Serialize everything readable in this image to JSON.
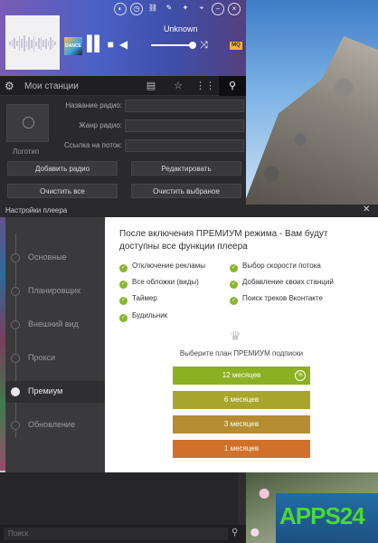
{
  "player": {
    "track": "Unknown",
    "cover_badge": "DANCE",
    "mq_badge": "MQ",
    "title_icons": [
      "palette-icon",
      "clock-icon",
      "link-icon",
      "pencil-icon",
      "wrench-icon",
      "pin-icon",
      "minimize-icon",
      "close-icon"
    ],
    "volume_level": 0.95
  },
  "stations_bar": {
    "label": "Мои станции"
  },
  "add_station": {
    "logo_label": "Логотип",
    "fields": [
      {
        "label": "Название радио:",
        "value": ""
      },
      {
        "label": "Жанр радио:",
        "value": ""
      },
      {
        "label": "Ссылка на поток:",
        "value": ""
      }
    ],
    "buttons": {
      "add": "Добавить радио",
      "edit": "Редактировать",
      "clear_all": "Очистить все",
      "clear_selected": "Очистить выбраное"
    }
  },
  "settings": {
    "title": "Настройки плеера",
    "nav": [
      "Основные",
      "Планировщик",
      "Внешний вид",
      "Прокси",
      "Премиум",
      "Обновление"
    ],
    "active_index": 4
  },
  "premium": {
    "headline": "После включения ПРЕМИУМ режима - Вам будут доступны все функции плеера",
    "features_left": [
      "Отключение рекламы",
      "Все обложки (виды)",
      "Таймер",
      "Будильник"
    ],
    "features_right": [
      "Выбор скорости потока",
      "Добавление своих станций",
      "Поиск треков Вконтакте"
    ],
    "plan_caption": "Выберите план ПРЕМИУМ подписки",
    "plans": [
      {
        "label": "12 месяцев",
        "color": "#8bb023"
      },
      {
        "label": "6 месяцев",
        "color": "#a8a52d"
      },
      {
        "label": "3 месяцев",
        "color": "#b58c31"
      },
      {
        "label": "1 месяцев",
        "color": "#d0702a"
      }
    ]
  },
  "search": {
    "placeholder": "Поиск"
  },
  "watermark": {
    "text": "APPS24"
  }
}
